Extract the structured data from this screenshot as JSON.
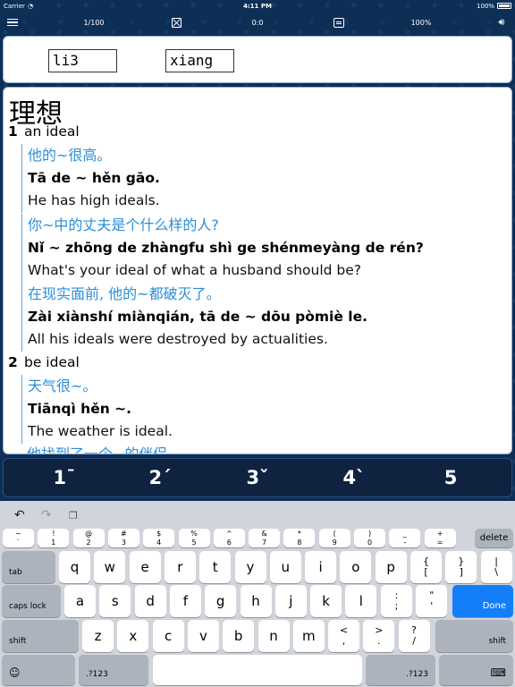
{
  "status_bar": {
    "carrier": "Carrier",
    "time": "4:11 PM",
    "battery": "100%"
  },
  "toolbar": {
    "page": "1/100",
    "score": "0:0",
    "zoom": "100%"
  },
  "inputs": {
    "syllable_1": "li3",
    "syllable_2": "xiang"
  },
  "entry": {
    "headword": "理想",
    "senses": [
      {
        "num": "1",
        "definition": "an ideal",
        "examples": [
          {
            "cn": "他的~很高。",
            "py": "Tā de ~ hěn gāo.",
            "en": "He has high ideals."
          },
          {
            "cn": "你~中的丈夫是个什么样的人?",
            "py": "Nǐ ~ zhōng de zhàngfu shì ge shénmeyàng de rén?",
            "en": "What's your ideal of what a husband should be?"
          },
          {
            "cn": "在现实面前, 他的~都破灭了。",
            "py": "Zài xiànshí miànqián, tā de ~ dōu pòmiè le.",
            "en": "All his ideals were destroyed by actualities."
          }
        ]
      },
      {
        "num": "2",
        "definition": "be ideal",
        "examples": [
          {
            "cn": "天气很~。",
            "py": "Tiānqì hěn ~.",
            "en": "The weather is ideal."
          }
        ]
      }
    ],
    "cut_off_line": "他找到了一个~的伴侣"
  },
  "tones": [
    "1ˉ",
    "2ˊ",
    "3ˇ",
    "4ˋ",
    "5"
  ],
  "keyboard": {
    "toolbar_icons": [
      "undo-icon",
      "redo-icon",
      "paste-icon"
    ],
    "row1": [
      {
        "top": "~",
        "bottom": "`"
      },
      {
        "top": "!",
        "bottom": "1"
      },
      {
        "top": "@",
        "bottom": "2"
      },
      {
        "top": "#",
        "bottom": "3"
      },
      {
        "top": "$",
        "bottom": "4"
      },
      {
        "top": "%",
        "bottom": "5"
      },
      {
        "top": "^",
        "bottom": "6"
      },
      {
        "top": "&",
        "bottom": "7"
      },
      {
        "top": "*",
        "bottom": "8"
      },
      {
        "top": "(",
        "bottom": "9"
      },
      {
        "top": ")",
        "bottom": "0"
      },
      {
        "top": "_",
        "bottom": "-"
      },
      {
        "top": "+",
        "bottom": "="
      }
    ],
    "delete": "delete",
    "tab": "tab",
    "row2": [
      "q",
      "w",
      "e",
      "r",
      "t",
      "y",
      "u",
      "i",
      "o",
      "p"
    ],
    "row2_sym": [
      {
        "top": "{",
        "bottom": "["
      },
      {
        "top": "}",
        "bottom": "]"
      },
      {
        "top": "|",
        "bottom": "\\"
      }
    ],
    "caps_lock": "caps lock",
    "row3": [
      "a",
      "s",
      "d",
      "f",
      "g",
      "h",
      "j",
      "k",
      "l"
    ],
    "row3_sym": [
      {
        "top": ":",
        "bottom": ";"
      },
      {
        "top": "\"",
        "bottom": "'"
      }
    ],
    "done": "Done",
    "shift": "shift",
    "row4": [
      "z",
      "x",
      "c",
      "v",
      "b",
      "n",
      "m"
    ],
    "row4_sym": [
      {
        "top": "<",
        "bottom": ","
      },
      {
        "top": ">",
        "bottom": "."
      },
      {
        "top": "?",
        "bottom": "/"
      }
    ],
    "numbers_key": ".?123",
    "emoji_glyph": "☺",
    "hide_glyph": "⌨"
  }
}
